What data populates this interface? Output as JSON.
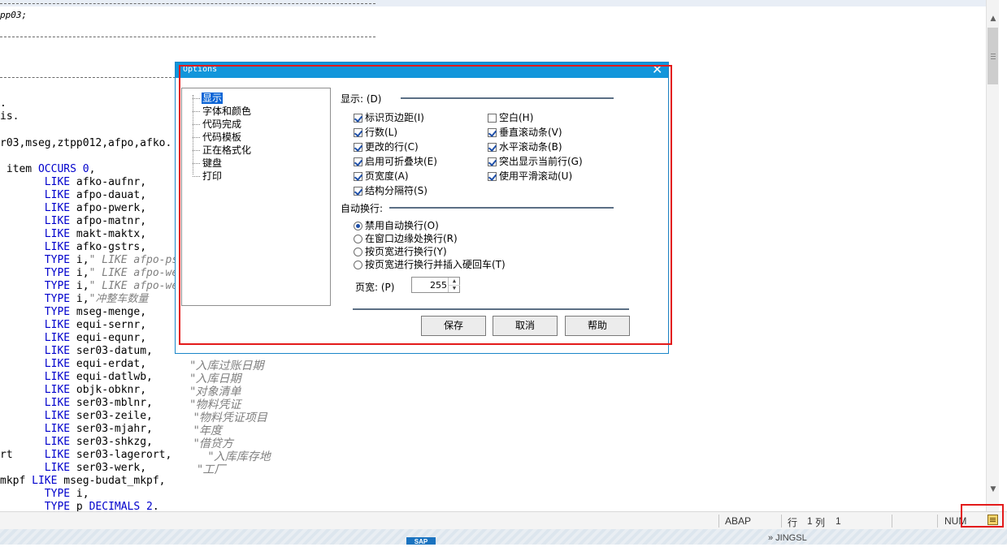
{
  "editor": {
    "header_line_1": "pp03;",
    "pre_lines": [
      ".",
      "is.",
      "r03,mseg,ztpp012,afpo,afko."
    ],
    "lines": [
      [
        {
          "t": " item ",
          "c": ""
        },
        {
          "t": "OCCURS",
          "c": "kw"
        },
        {
          "t": " ",
          "c": ""
        },
        {
          "t": "0",
          "c": "kw"
        },
        {
          "t": ",",
          "c": ""
        }
      ],
      [
        {
          "t": "       ",
          "c": ""
        },
        {
          "t": "LIKE",
          "c": "kw"
        },
        {
          "t": " afko-aufnr,",
          "c": ""
        }
      ],
      [
        {
          "t": "       ",
          "c": ""
        },
        {
          "t": "LIKE",
          "c": "kw"
        },
        {
          "t": " afpo-dauat,",
          "c": ""
        }
      ],
      [
        {
          "t": "       ",
          "c": ""
        },
        {
          "t": "LIKE",
          "c": "kw"
        },
        {
          "t": " afpo-pwerk,",
          "c": ""
        }
      ],
      [
        {
          "t": "       ",
          "c": ""
        },
        {
          "t": "LIKE",
          "c": "kw"
        },
        {
          "t": " afpo-matnr,",
          "c": ""
        }
      ],
      [
        {
          "t": "       ",
          "c": ""
        },
        {
          "t": "LIKE",
          "c": "kw"
        },
        {
          "t": " makt-maktx,",
          "c": ""
        }
      ],
      [
        {
          "t": "       ",
          "c": ""
        },
        {
          "t": "LIKE",
          "c": "kw"
        },
        {
          "t": " afko-gstrs,",
          "c": ""
        }
      ],
      [
        {
          "t": "       ",
          "c": ""
        },
        {
          "t": "TYPE",
          "c": "kw"
        },
        {
          "t": " i,",
          "c": ""
        },
        {
          "t": "\" LIKE afpo-psm",
          "c": "cm"
        }
      ],
      [
        {
          "t": "       ",
          "c": ""
        },
        {
          "t": "TYPE",
          "c": "kw"
        },
        {
          "t": " i,",
          "c": ""
        },
        {
          "t": "\" LIKE afpo-wem",
          "c": "cm"
        }
      ],
      [
        {
          "t": "       ",
          "c": ""
        },
        {
          "t": "TYPE",
          "c": "kw"
        },
        {
          "t": " i,",
          "c": ""
        },
        {
          "t": "\" LIKE afpo-wem",
          "c": "cm"
        }
      ],
      [
        {
          "t": "       ",
          "c": ""
        },
        {
          "t": "TYPE",
          "c": "kw"
        },
        {
          "t": " i,",
          "c": ""
        },
        {
          "t": "\"冲整车数量",
          "c": "cm"
        }
      ],
      [
        {
          "t": "       ",
          "c": ""
        },
        {
          "t": "TYPE",
          "c": "kw"
        },
        {
          "t": " mseg-menge,",
          "c": ""
        }
      ],
      [
        {
          "t": "       ",
          "c": ""
        },
        {
          "t": "LIKE",
          "c": "kw"
        },
        {
          "t": " equi-sernr,",
          "c": ""
        }
      ],
      [
        {
          "t": "       ",
          "c": ""
        },
        {
          "t": "LIKE",
          "c": "kw"
        },
        {
          "t": " equi-equnr,",
          "c": ""
        }
      ],
      [
        {
          "t": "       ",
          "c": ""
        },
        {
          "t": "LIKE",
          "c": "kw"
        },
        {
          "t": " ser03-datum,",
          "c": ""
        }
      ],
      [
        {
          "t": "       ",
          "c": ""
        },
        {
          "t": "LIKE",
          "c": "kw"
        },
        {
          "t": " equi-erdat,",
          "c": ""
        }
      ],
      [
        {
          "t": "       ",
          "c": ""
        },
        {
          "t": "LIKE",
          "c": "kw"
        },
        {
          "t": " equi-datlwb,",
          "c": ""
        }
      ],
      [
        {
          "t": "       ",
          "c": ""
        },
        {
          "t": "LIKE",
          "c": "kw"
        },
        {
          "t": " objk-obknr,",
          "c": ""
        }
      ],
      [
        {
          "t": "       ",
          "c": ""
        },
        {
          "t": "LIKE",
          "c": "kw"
        },
        {
          "t": " ser03-mblnr,",
          "c": ""
        }
      ],
      [
        {
          "t": "       ",
          "c": ""
        },
        {
          "t": "LIKE",
          "c": "kw"
        },
        {
          "t": " ser03-zeile,",
          "c": ""
        }
      ],
      [
        {
          "t": "       ",
          "c": ""
        },
        {
          "t": "LIKE",
          "c": "kw"
        },
        {
          "t": " ser03-mjahr,",
          "c": ""
        }
      ],
      [
        {
          "t": "       ",
          "c": ""
        },
        {
          "t": "LIKE",
          "c": "kw"
        },
        {
          "t": " ser03-shkzg,",
          "c": ""
        }
      ],
      [
        {
          "t": "rt     ",
          "c": ""
        },
        {
          "t": "LIKE",
          "c": "kw"
        },
        {
          "t": " ser03-lagerort,",
          "c": ""
        }
      ],
      [
        {
          "t": "       ",
          "c": ""
        },
        {
          "t": "LIKE",
          "c": "kw"
        },
        {
          "t": " ser03-werk,",
          "c": ""
        }
      ],
      [
        {
          "t": "mkpf ",
          "c": ""
        },
        {
          "t": "LIKE",
          "c": "kw"
        },
        {
          "t": " mseg-budat_mkpf,",
          "c": ""
        }
      ],
      [
        {
          "t": "       ",
          "c": ""
        },
        {
          "t": "TYPE",
          "c": "kw"
        },
        {
          "t": " i,",
          "c": ""
        }
      ],
      [
        {
          "t": "       ",
          "c": ""
        },
        {
          "t": "TYPE",
          "c": "kw"
        },
        {
          "t": " p ",
          "c": ""
        },
        {
          "t": "DECIMALS",
          "c": "kw"
        },
        {
          "t": " ",
          "c": ""
        },
        {
          "t": "2",
          "c": "kw"
        },
        {
          "t": ".",
          "c": ""
        }
      ]
    ],
    "right_comments": [
      {
        "row": 15,
        "text": "\"入库过账日期"
      },
      {
        "row": 16,
        "text": "\"入库日期"
      },
      {
        "row": 17,
        "text": "\"对象清单"
      },
      {
        "row": 18,
        "text": "\"物料凭证"
      },
      {
        "row": 19,
        "text": " \"物料凭证项目"
      },
      {
        "row": 20,
        "text": " \"年度"
      },
      {
        "row": 21,
        "text": " \"借贷方"
      },
      {
        "row": 22,
        "text": "     \"入库库存地"
      },
      {
        "row": 23,
        "text": "  \"工厂"
      }
    ]
  },
  "scrollbar": {
    "up": "▲",
    "down": "▼"
  },
  "status": {
    "lang": "ABAP",
    "row_label": "行",
    "row_value": "1",
    "col_label": "列",
    "col_value": "1",
    "num": "NUM"
  },
  "bottom": {
    "sap": "SAP",
    "right_text": "»  JINGSL"
  },
  "dialog": {
    "title": "Options",
    "close": "✕",
    "tree": [
      "显示",
      "字体和颜色",
      "代码完成",
      "代码模板",
      "正在格式化",
      "键盘",
      "打印"
    ],
    "selected_tree": 0,
    "display_group": "显示: (D)",
    "left_checks": [
      {
        "label": "标识页边距(I)",
        "checked": true
      },
      {
        "label": "行数(L)",
        "checked": true
      },
      {
        "label": "更改的行(C)",
        "checked": true
      },
      {
        "label": "启用可折叠块(E)",
        "checked": true
      },
      {
        "label": "页宽度(A)",
        "checked": true
      },
      {
        "label": "结构分隔符(S)",
        "checked": true
      }
    ],
    "right_checks": [
      {
        "label": "空白(H)",
        "checked": false
      },
      {
        "label": "垂直滚动条(V)",
        "checked": true
      },
      {
        "label": "水平滚动条(B)",
        "checked": true
      },
      {
        "label": "突出显示当前行(G)",
        "checked": true
      },
      {
        "label": "使用平滑滚动(U)",
        "checked": true
      }
    ],
    "wrap_group": "自动换行:",
    "radios": [
      {
        "label": "禁用自动换行(O)",
        "checked": true
      },
      {
        "label": "在窗口边缘处换行(R)",
        "checked": false
      },
      {
        "label": "按页宽进行换行(Y)",
        "checked": false
      },
      {
        "label": "按页宽进行换行并插入硬回车(T)",
        "checked": false
      }
    ],
    "page_width_label": "页宽: (P)",
    "page_width_value": "255",
    "buttons": {
      "save": "保存",
      "cancel": "取消",
      "help": "帮助"
    }
  }
}
